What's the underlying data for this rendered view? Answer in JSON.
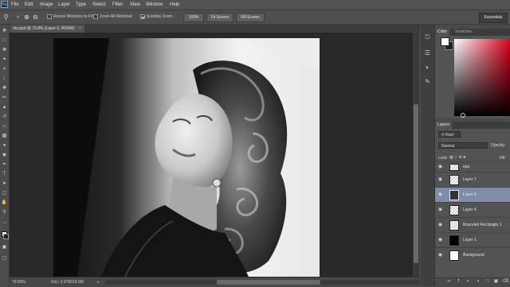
{
  "menubar": {
    "logo": "Ps",
    "items": [
      "File",
      "Edit",
      "Image",
      "Layer",
      "Type",
      "Select",
      "Filter",
      "View",
      "Window",
      "Help"
    ]
  },
  "options": {
    "resize_windows_label": "Resize Windows to Fit",
    "resize_windows_checked": false,
    "zoom_all_label": "Zoom All Windows",
    "zoom_all_checked": false,
    "scrubby_zoom_label": "Scrubby Zoom",
    "scrubby_zoom_checked": true,
    "btn_100": "100%",
    "btn_fit": "Fit Screen",
    "btn_fill": "Fill Screen",
    "workspace": "Essentials"
  },
  "document": {
    "tab_title": "rita.psd @ 79.8% (Layer 6, RGB/8)",
    "close": "×"
  },
  "status": {
    "zoom": "79.83%",
    "doc": "Doc: 2.97M/19.3M"
  },
  "color_panel": {
    "tabs": [
      "Color",
      "Swatches"
    ],
    "foreground": "#ffffff",
    "background": "#222222",
    "hue": "#e0001e"
  },
  "layers_panel": {
    "tab": "Layers",
    "kind_label": "Kind",
    "blend_mode": "Normal",
    "opacity_label": "Opacity:",
    "lock_label": "Lock:",
    "fill_label": "Fill:",
    "selected_layer": "Layer 6",
    "layers": [
      {
        "name": "eps",
        "thumb": "checker"
      },
      {
        "name": "Layer 7",
        "thumb": "checker"
      },
      {
        "name": "Layer 6",
        "thumb": "dark"
      },
      {
        "name": "Layer 4",
        "thumb": "checker"
      },
      {
        "name": "Rounded Rectangle 1",
        "thumb": "light"
      },
      {
        "name": "Layer 1",
        "thumb": "black"
      },
      {
        "name": "Background",
        "thumb": "white"
      }
    ]
  }
}
